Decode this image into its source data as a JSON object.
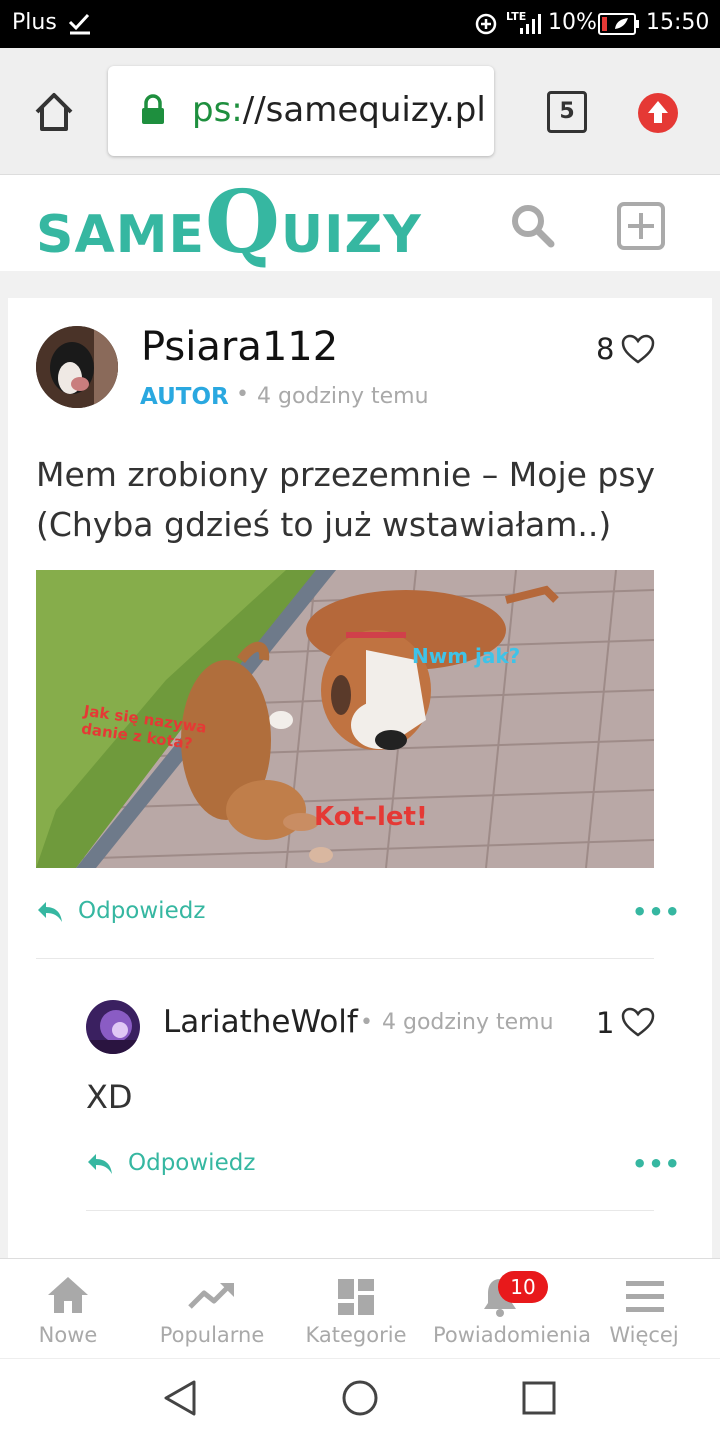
{
  "status_bar": {
    "carrier": "Plus",
    "network": "LTE",
    "battery": "10%",
    "time": "15:50"
  },
  "browser": {
    "url_scheme": "ps:",
    "url_rest": "//samequizy.pl",
    "tab_count": "5"
  },
  "site": {
    "logo_same": "SAME",
    "logo_q": "Q",
    "logo_uizy": "UIZY",
    "brand_color": "#36b7a1"
  },
  "post": {
    "author": "Psiara112",
    "role": "AUTOR",
    "time": "4 godziny temu",
    "likes": "8",
    "text": "Mem zrobiony przezemnie – Moje psy (Chyba gdzieś to już wstawiałam..)",
    "meme_text_1": "Jak się nazywa danie z kota?",
    "meme_text_2": "Nwm jak?",
    "meme_text_3": "Kot–let!",
    "reply_label": "Odpowiedz"
  },
  "comment": {
    "author": "LariatheWolf",
    "time": "4 godziny temu",
    "likes": "1",
    "text": "XD",
    "reply_label": "Odpowiedz"
  },
  "bottom_nav": {
    "items": [
      {
        "label": "Nowe",
        "icon": "home-icon"
      },
      {
        "label": "Popularne",
        "icon": "trending-icon"
      },
      {
        "label": "Kategorie",
        "icon": "grid-icon"
      },
      {
        "label": "Powiadomienia",
        "icon": "bell-icon"
      },
      {
        "label": "Więcej",
        "icon": "menu-icon"
      }
    ],
    "notification_badge": "10"
  }
}
